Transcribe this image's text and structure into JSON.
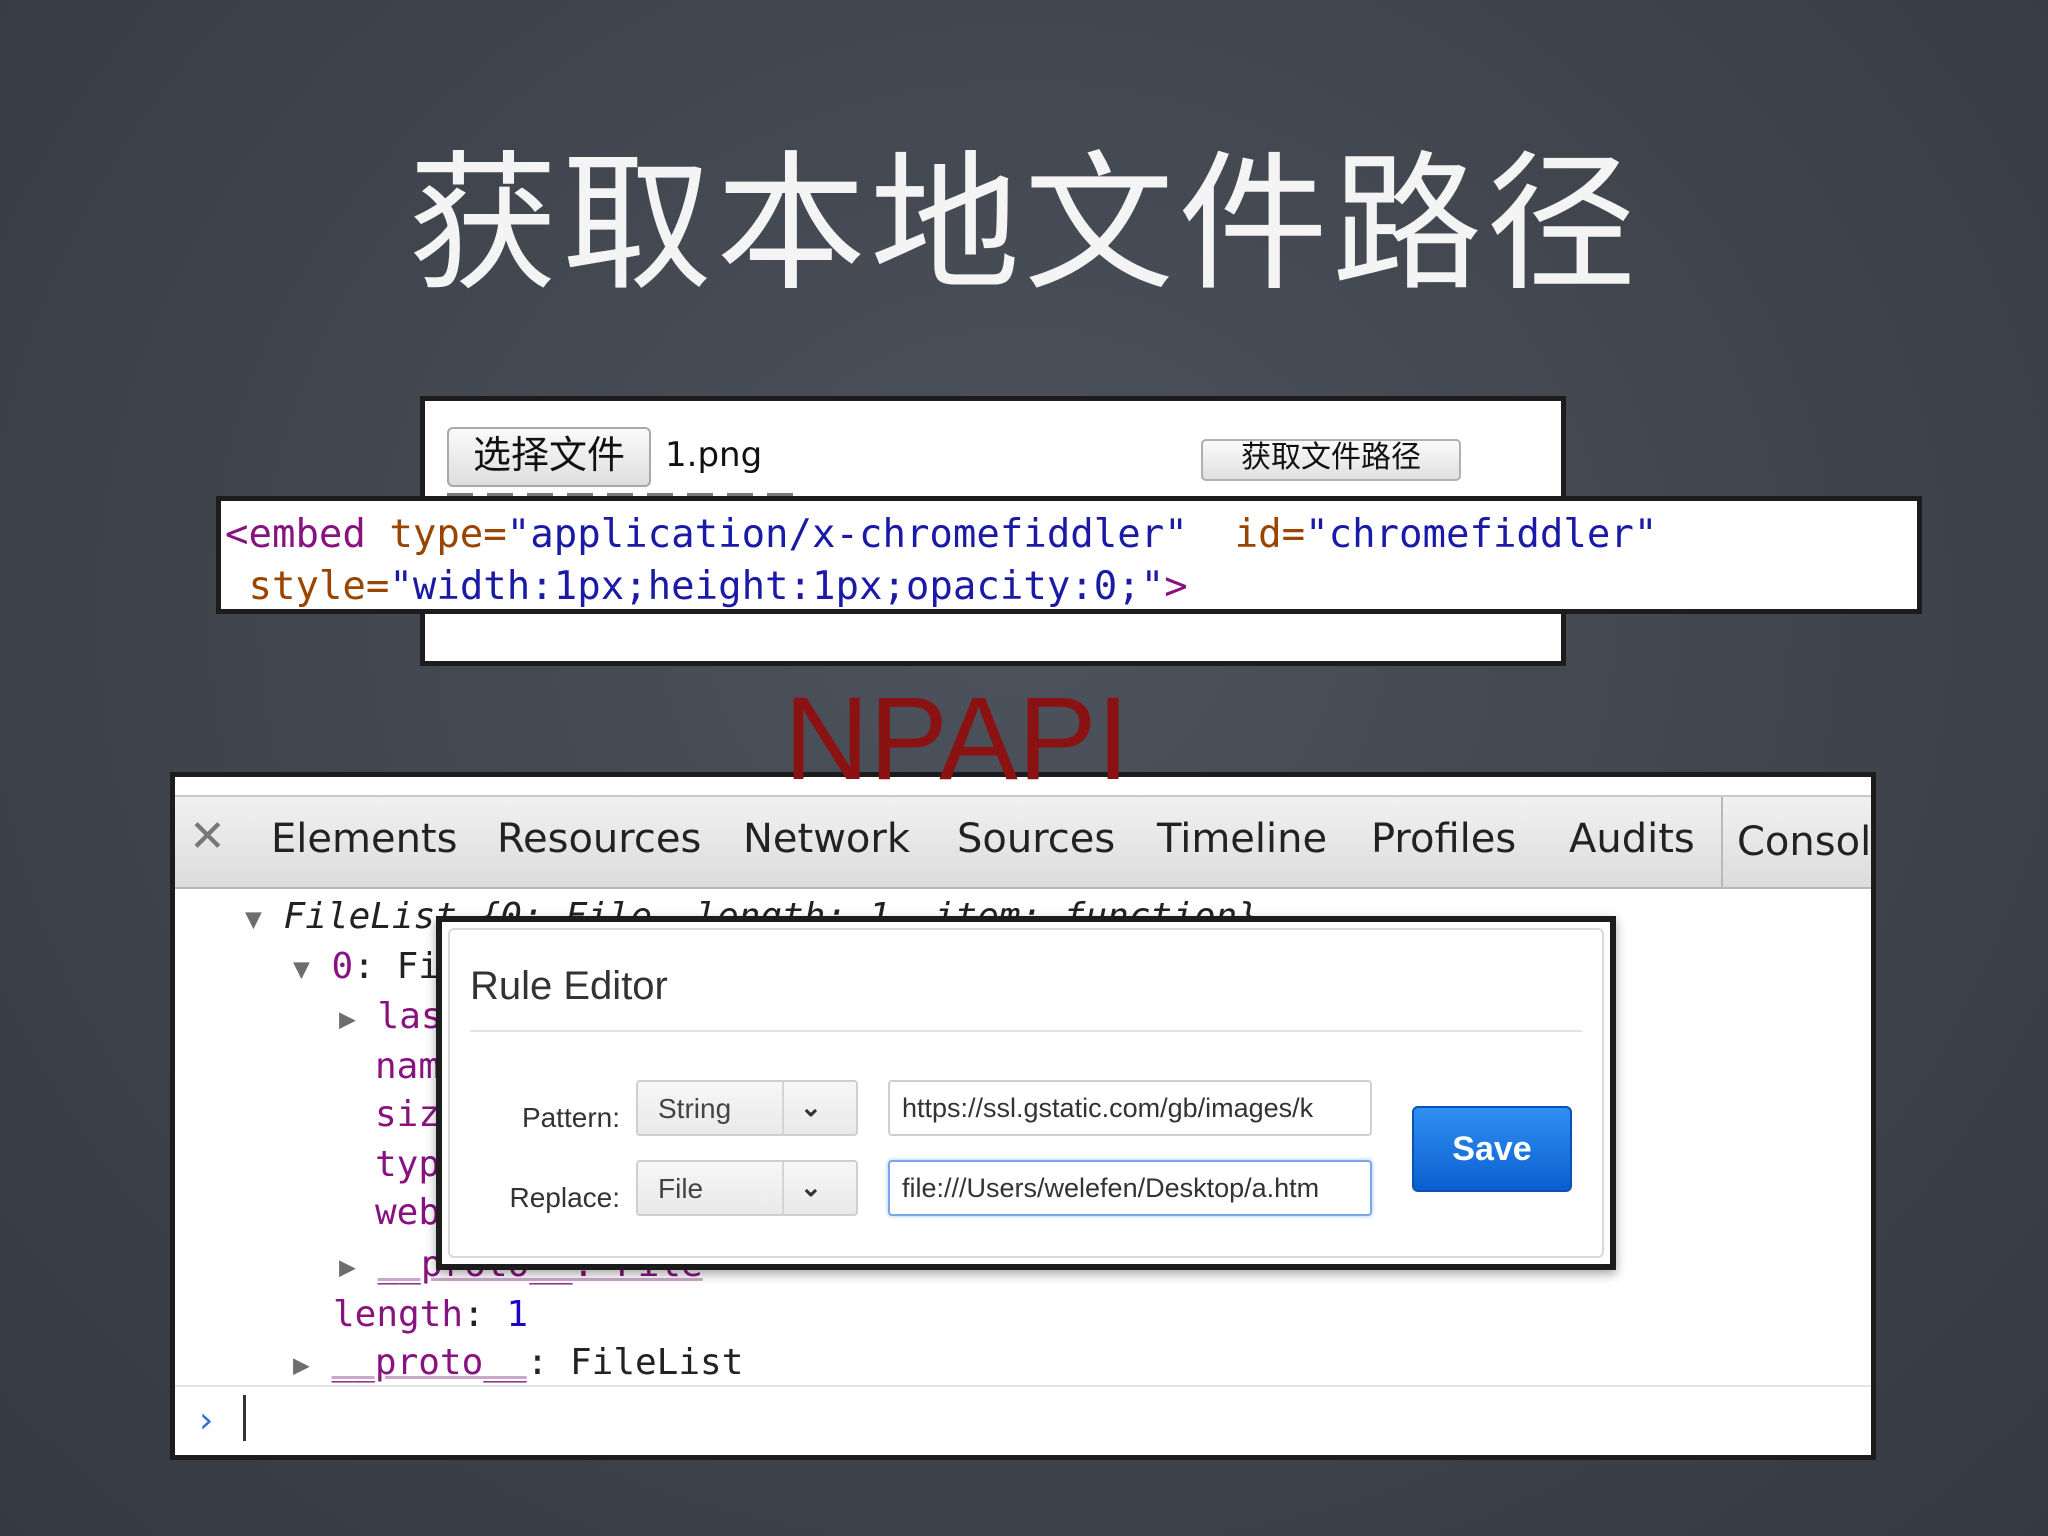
{
  "slide": {
    "title": "获取本地文件路径"
  },
  "file_panel": {
    "choose_button": "选择文件",
    "file_name": "1.png",
    "get_path_button": "获取文件路径"
  },
  "embed_code": {
    "line1": {
      "open": "<embed",
      "type_attr": " type=",
      "type_val": "\"application/x-chromefiddler\"",
      "id_attr": "  id=",
      "id_val": "\"chromefiddler\""
    },
    "line2": {
      "style_attr": " style=",
      "style_val": "\"width:1px;height:1px;opacity:0;\"",
      "close": ">"
    }
  },
  "npapi_label": "NPAPI",
  "devtools": {
    "close_icon": "close-icon",
    "tabs": [
      "Elements",
      "Resources",
      "Network",
      "Sources",
      "Timeline",
      "Profiles",
      "Audits",
      "Consol"
    ],
    "console": {
      "filelist_head": "FileList {0: File, length: 1, item: function}",
      "item0_key": "0",
      "item0_val": ": Fi",
      "props": [
        "las",
        "nam",
        "siz",
        "typ",
        "web"
      ],
      "inner_proto": "__proto__: File",
      "length_key": "length",
      "length_val": "1",
      "proto_key": "__proto__",
      "proto_val": ": FileList",
      "prompt_symbol": "›"
    }
  },
  "rule_editor": {
    "title": "Rule Editor",
    "pattern_label": "Pattern:",
    "pattern_type": "String",
    "pattern_value": "https://ssl.gstatic.com/gb/images/k",
    "replace_label": "Replace:",
    "replace_type": "File",
    "replace_value": "file:///Users/welefen/Desktop/a.htm",
    "save_label": "Save",
    "accent_color": "#0b5fd1"
  }
}
